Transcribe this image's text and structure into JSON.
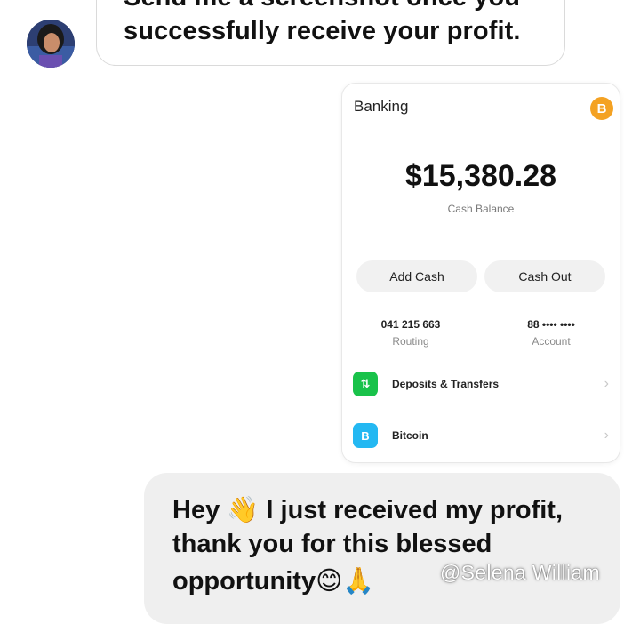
{
  "chat": {
    "top_bubble": {
      "line1": "Send me a screenshot once you",
      "line2": "successfully receive your profit."
    },
    "bottom_bubble": {
      "line1": "Hey 👋 I just received my profit,",
      "line2": "thank you for this blessed",
      "line3": "opportunity😊🙏"
    }
  },
  "banking_card": {
    "title": "Banking",
    "bitcoin_badge": "B",
    "balance": "$15,380.28",
    "balance_label": "Cash Balance",
    "add_cash": "Add Cash",
    "cash_out": "Cash Out",
    "routing_number": "041 215 663",
    "routing_label": "Routing",
    "account_number": "88 •••• ••••",
    "account_label": "Account",
    "rows": [
      {
        "icon": "arrows-icon",
        "icon_text": "⇅",
        "label": "Deposits & Transfers",
        "color": "#19c24a"
      },
      {
        "icon": "bitcoin-icon",
        "icon_text": "B",
        "label": "Bitcoin",
        "color": "#24b8f2"
      }
    ],
    "chevron": "›"
  },
  "watermark": "@Selena William",
  "colors": {
    "bitcoin_orange": "#f4a223",
    "green": "#19c24a",
    "blue": "#24b8f2",
    "bubble_grey": "#efefef"
  }
}
